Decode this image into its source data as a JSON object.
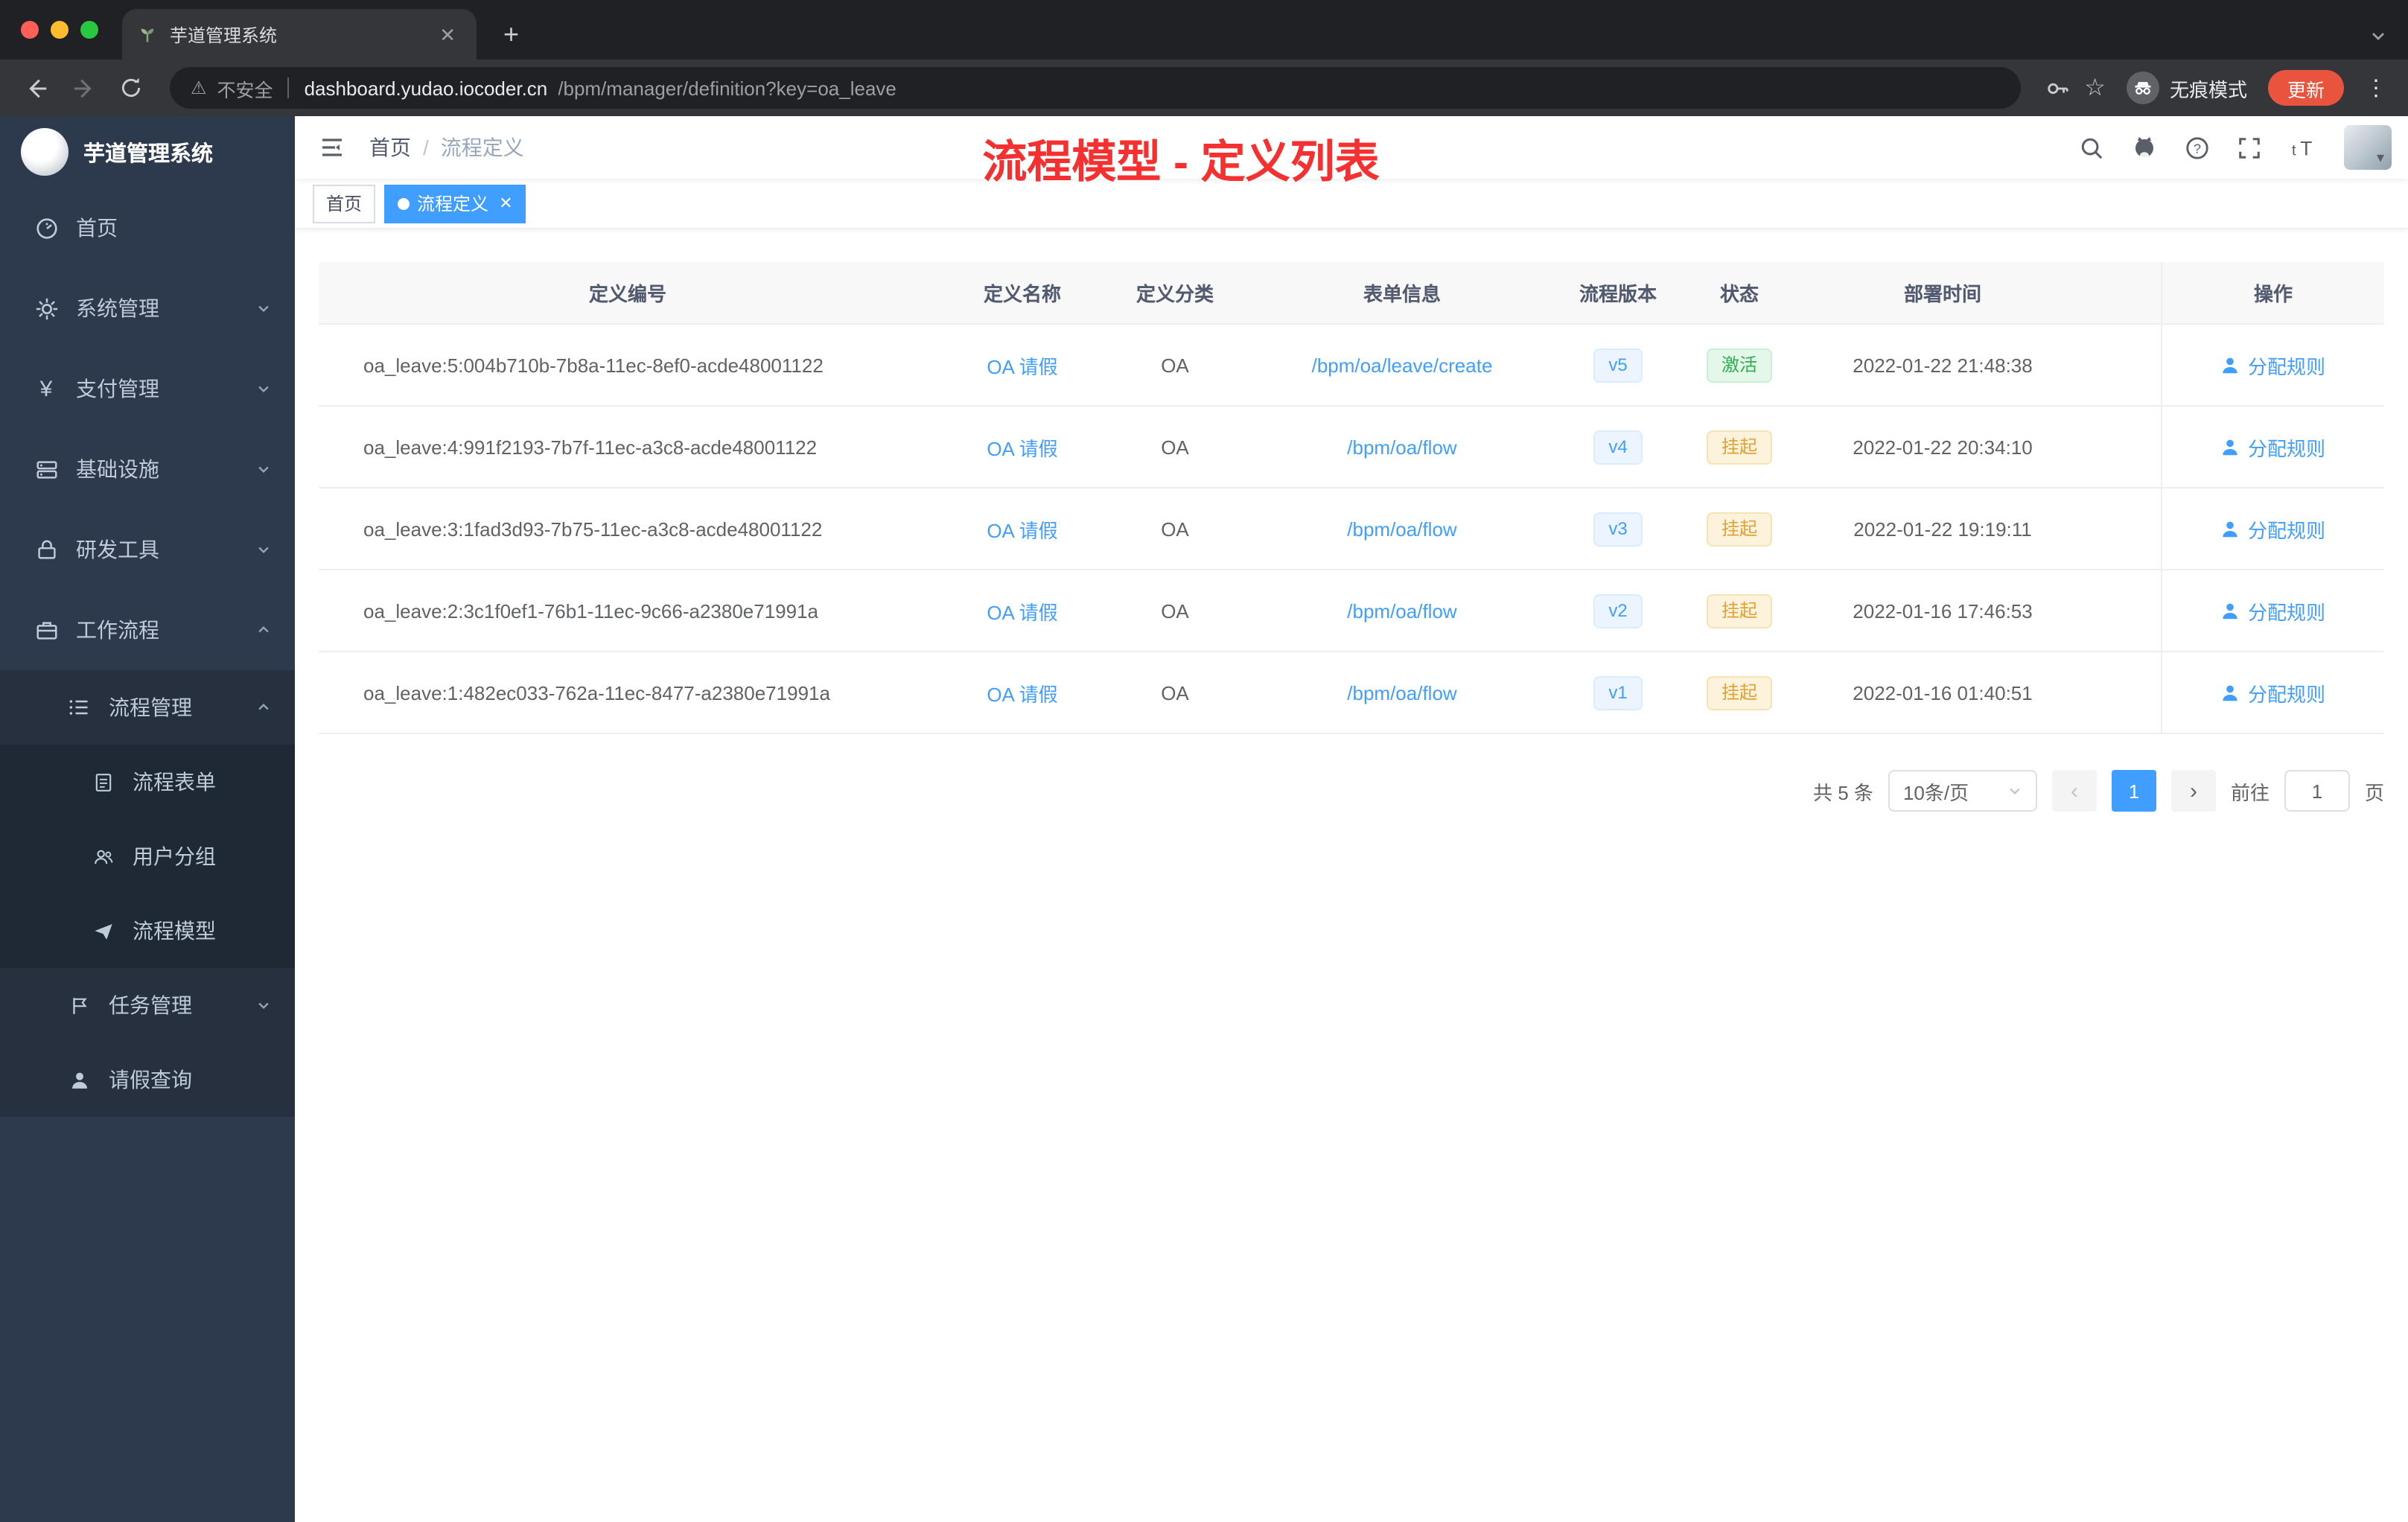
{
  "browser": {
    "tab_title": "芋道管理系统",
    "security_label": "不安全",
    "url_domain": "dashboard.yudao.iocoder.cn",
    "url_path": "/bpm/manager/definition?key=oa_leave",
    "incognito_label": "无痕模式",
    "update_label": "更新"
  },
  "sidebar": {
    "app_title": "芋道管理系统",
    "items": {
      "home": "首页",
      "system": "系统管理",
      "payment": "支付管理",
      "infra": "基础设施",
      "devtools": "研发工具",
      "workflow": "工作流程",
      "process_manage": "流程管理",
      "process_form": "流程表单",
      "user_group": "用户分组",
      "process_model": "流程模型",
      "task_manage": "任务管理",
      "leave_query": "请假查询"
    }
  },
  "header": {
    "breadcrumb_home": "首页",
    "breadcrumb_sep": "/",
    "breadcrumb_current": "流程定义",
    "annotation_title": "流程模型 - 定义列表"
  },
  "tags": {
    "home": "首页",
    "active": "流程定义"
  },
  "table": {
    "headers": [
      "定义编号",
      "定义名称",
      "定义分类",
      "表单信息",
      "流程版本",
      "状态",
      "部署时间",
      "操作"
    ],
    "action_label": "分配规则",
    "rows": [
      {
        "id": "oa_leave:5:004b710b-7b8a-11ec-8ef0-acde48001122",
        "name": "OA 请假",
        "category": "OA",
        "form": "/bpm/oa/leave/create",
        "version": "v5",
        "status": "激活",
        "time": "2022-01-22 21:48:38"
      },
      {
        "id": "oa_leave:4:991f2193-7b7f-11ec-a3c8-acde48001122",
        "name": "OA 请假",
        "category": "OA",
        "form": "/bpm/oa/flow",
        "version": "v4",
        "status": "挂起",
        "time": "2022-01-22 20:34:10"
      },
      {
        "id": "oa_leave:3:1fad3d93-7b75-11ec-a3c8-acde48001122",
        "name": "OA 请假",
        "category": "OA",
        "form": "/bpm/oa/flow",
        "version": "v3",
        "status": "挂起",
        "time": "2022-01-22 19:19:11"
      },
      {
        "id": "oa_leave:2:3c1f0ef1-76b1-11ec-9c66-a2380e71991a",
        "name": "OA 请假",
        "category": "OA",
        "form": "/bpm/oa/flow",
        "version": "v2",
        "status": "挂起",
        "time": "2022-01-16 17:46:53"
      },
      {
        "id": "oa_leave:1:482ec033-762a-11ec-8477-a2380e71991a",
        "name": "OA 请假",
        "category": "OA",
        "form": "/bpm/oa/flow",
        "version": "v1",
        "status": "挂起",
        "time": "2022-01-16 01:40:51"
      }
    ]
  },
  "pagination": {
    "total": "共 5 条",
    "page_size": "10条/页",
    "prev": "‹",
    "next": "›",
    "current_page": "1",
    "goto_label": "前往",
    "goto_value": "1",
    "goto_suffix": "页"
  }
}
